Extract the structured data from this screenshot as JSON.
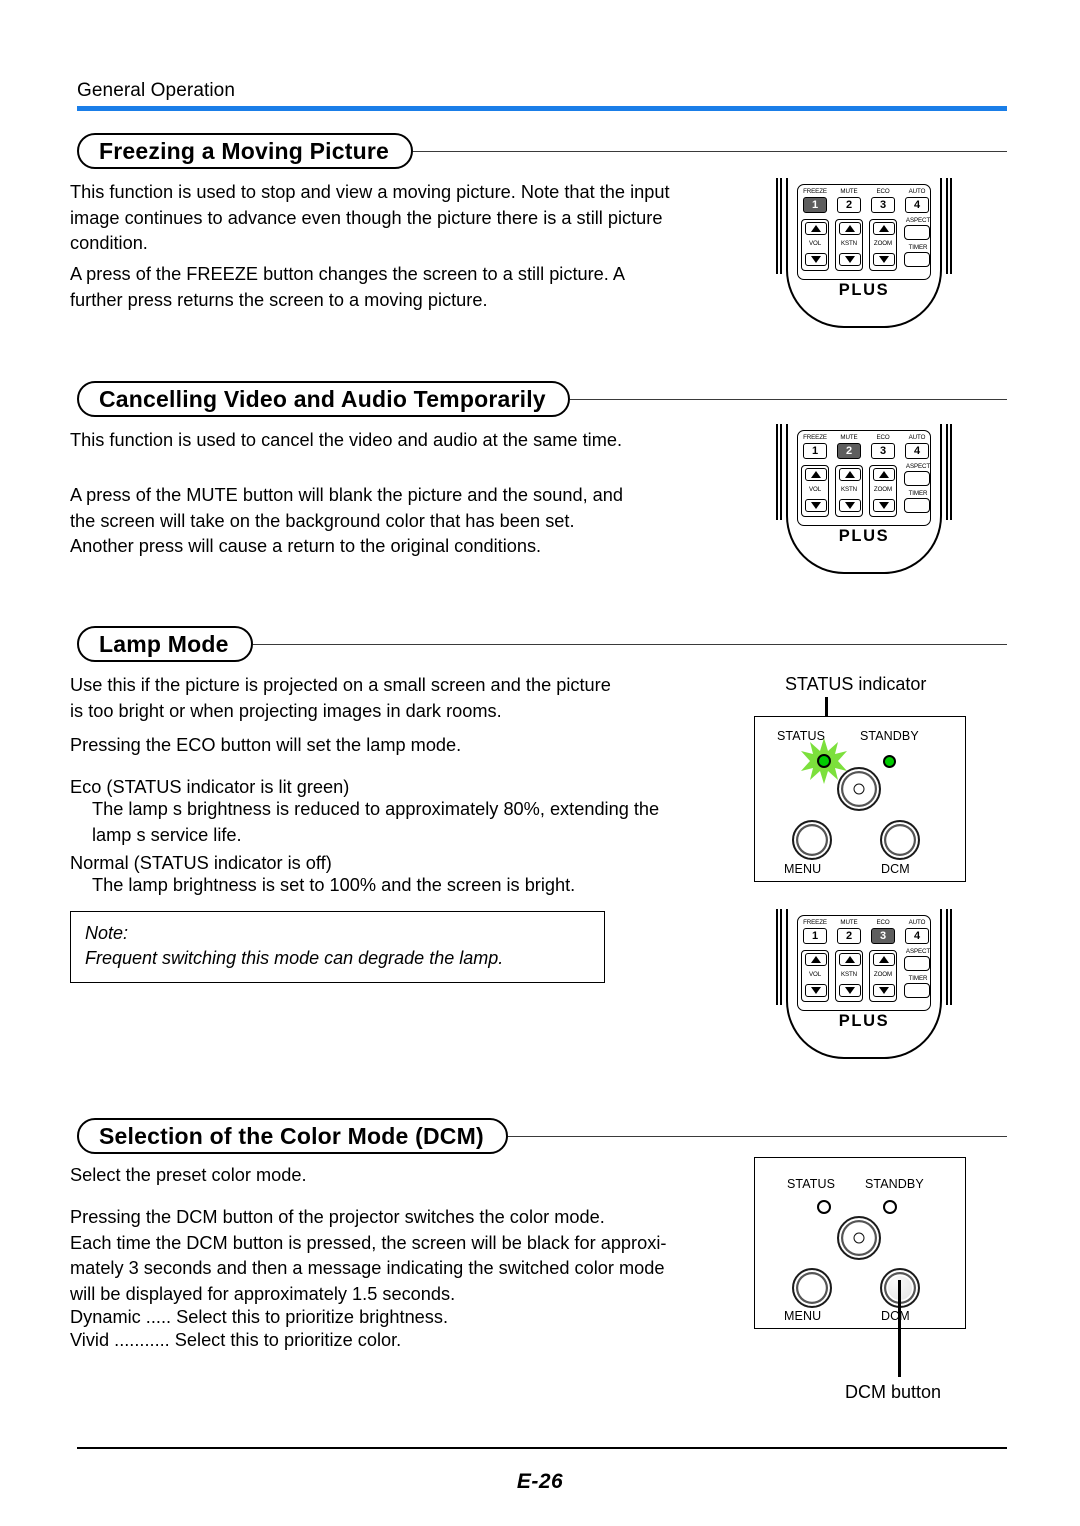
{
  "header": {
    "breadcrumb": "General Operation",
    "rule_color": "#1a7ee8"
  },
  "sections": [
    {
      "id": "freezing",
      "title": "Freezing a Moving Picture",
      "paragraphs": [
        "This function is used to stop and view a moving picture. Note that the input\nimage continues to advance even though the picture there is a still picture\ncondition.",
        "A press of the FREEZE button changes the screen to a still picture. A\nfurther press returns the screen to a moving picture."
      ]
    },
    {
      "id": "cancelling",
      "title": "Cancelling Video and Audio Temporarily",
      "paragraphs": [
        "This function is used to cancel the video and audio at the same time.",
        "A press of the MUTE button will blank the picture and the sound, and\nthe screen will take on the background color that has been set.\nAnother press will cause a return to the original conditions."
      ]
    },
    {
      "id": "lamp-mode",
      "title": "Lamp Mode",
      "paragraphs": [
        "Use this if the picture is projected on a small screen and the picture\nis too bright or when projecting images in dark rooms.",
        "Pressing the ECO button will set the lamp mode.",
        "Eco (STATUS indicator is lit green)"
      ],
      "eco_detail": "The lamp s brightness is reduced to approximately 80%, extending the\nlamp s service life.",
      "normal_heading": "Normal (STATUS indicator is off)",
      "normal_detail": "The lamp brightness is set to 100% and the screen is bright.",
      "note": {
        "label": "Note:",
        "text": "Frequent switching this mode can degrade the lamp."
      }
    },
    {
      "id": "dcm",
      "title": "Selection of the Color Mode (DCM)",
      "paragraphs": [
        "Select the preset color mode.",
        "Pressing the DCM button of the projector switches the color mode.\nEach time the DCM button is pressed, the screen will be black for approxi-\nmately 3 seconds and then a message indicating the switched color mode\nwill be displayed for approximately 1.5 seconds."
      ],
      "modes": [
        "Dynamic ..... Select this to prioritize brightness.",
        "Vivid ........... Select this to prioritize color."
      ]
    }
  ],
  "remote": {
    "brand": "PLUS",
    "top_labels": [
      "FREEZE",
      "MUTE",
      "ECO",
      "AUTO"
    ],
    "number_keys": [
      "1",
      "2",
      "3",
      "4"
    ],
    "arrow_labels": [
      "VOL",
      "KSTN",
      "ZOOM"
    ],
    "side_keys": [
      "ASPECT",
      "TIMER"
    ],
    "instances": [
      {
        "highlight": "1"
      },
      {
        "highlight": "2"
      },
      {
        "highlight": "3"
      }
    ]
  },
  "control_panel": {
    "status_label": "STATUS",
    "standby_label": "STANDBY",
    "menu_label": "MENU",
    "dcm_label": "DCM",
    "callouts": {
      "status_indicator": "STATUS indicator",
      "dcm_button": "DCM button"
    },
    "colors": {
      "led_green": "#00cc00",
      "glow_green": "#7ce03c"
    }
  },
  "footer": {
    "page": "E-26"
  }
}
